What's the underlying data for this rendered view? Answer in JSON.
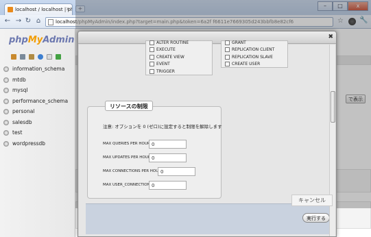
{
  "browser": {
    "tab_title": "localhost / localhost | phpM",
    "tab_close": "×",
    "new_tab": "+",
    "window_buttons": [
      "–",
      "□",
      "x"
    ],
    "url_host": "localhost",
    "url_path": "/phpMyAdmin/index.php?target=main.php&token=6a2f f6611e7669305d243bbfb8e82cf6"
  },
  "pma": {
    "logo_php": "php",
    "logo_my": "My",
    "logo_admin": "Admin",
    "databases": [
      "information_schema",
      "mtdb",
      "mysql",
      "performance_schema",
      "personal",
      "salesdb",
      "test",
      "wordpressdb"
    ],
    "show_button": "で表示"
  },
  "dialog": {
    "close": "✖",
    "priv_col1": [
      "ALTER ROUTINE",
      "EXECUTE",
      "CREATE VIEW",
      "EVENT",
      "TRIGGER"
    ],
    "priv_col2": [
      "GRANT",
      "REPLICATION CLIENT",
      "REPLICATION SLAVE",
      "CREATE USER"
    ],
    "limits_legend": "リソースの制限",
    "note": "注意: オプションを 0 (ゼロ)に設定すると制限を解除します",
    "fields": [
      {
        "label": "MAX QUERIES PER HOUR",
        "value": "0"
      },
      {
        "label": "MAX UPDATES PER HOUR",
        "value": "0"
      },
      {
        "label": "MAX CONNECTIONS PER HOUR",
        "value": "0"
      },
      {
        "label": "MAX USER_CONNECTIONS",
        "value": "0"
      }
    ],
    "go_button": "実行する",
    "cancel_button": "キャンセル"
  }
}
